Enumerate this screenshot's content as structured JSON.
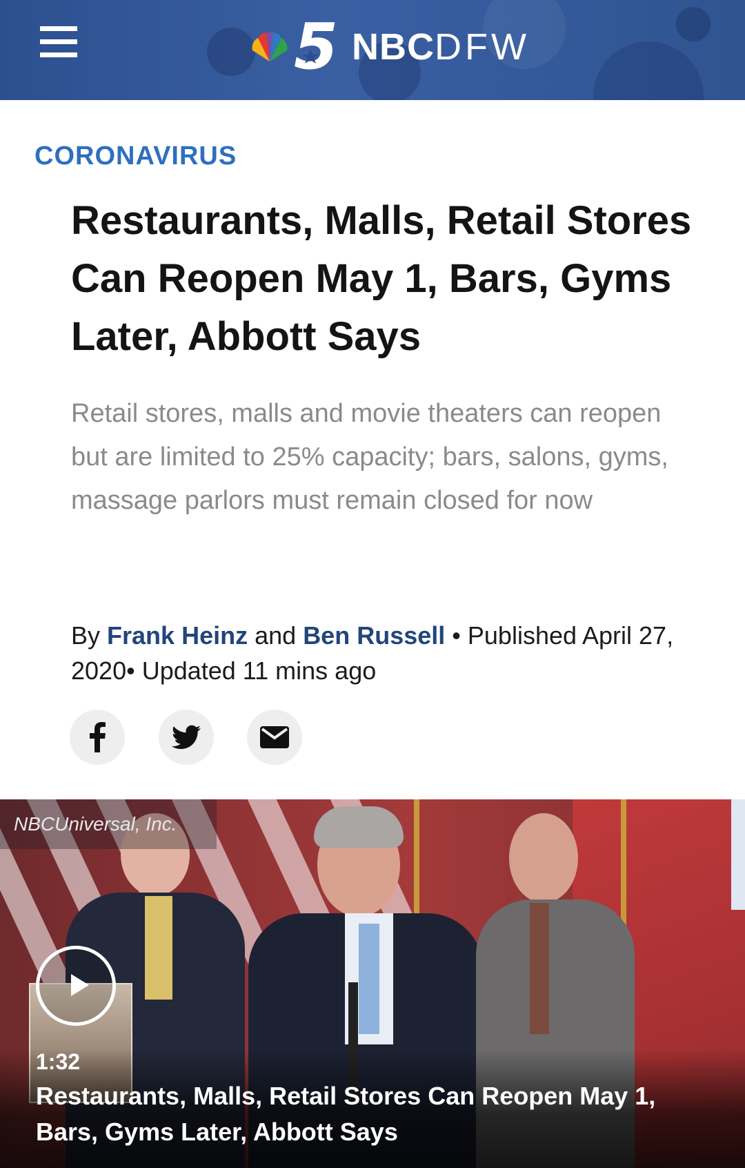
{
  "header": {
    "brand_number": "5",
    "brand_bold": "NBC",
    "brand_light": "DFW",
    "menu_icon": "hamburger-menu-icon",
    "logo_icon": "nbc-peacock-icon",
    "colors": {
      "header_bg": "#3a60a3",
      "accent": "#2f6fbf",
      "author": "#22457a"
    }
  },
  "article": {
    "category": "CORONAVIRUS",
    "headline": "Restaurants, Malls, Retail Stores Can Reopen May 1, Bars, Gyms Later, Abbott Says",
    "dek": "Retail stores, malls and movie theaters can reopen but are limited to 25% capacity; bars, salons, gyms, massage parlors must remain closed for now",
    "byline": {
      "by": "By",
      "author1": "Frank Heinz",
      "and": "and",
      "author2": "Ben Russell",
      "published": "• Published April 27, 2020• Updated 11 mins ago"
    },
    "share": [
      {
        "icon": "facebook-icon"
      },
      {
        "icon": "twitter-icon"
      },
      {
        "icon": "email-icon"
      }
    ]
  },
  "video": {
    "watermark": "NBCUniversal, Inc.",
    "duration": "1:32",
    "title": "Restaurants, Malls, Retail Stores Can Reopen May 1, Bars, Gyms Later, Abbott Says",
    "play_icon": "play-icon"
  }
}
